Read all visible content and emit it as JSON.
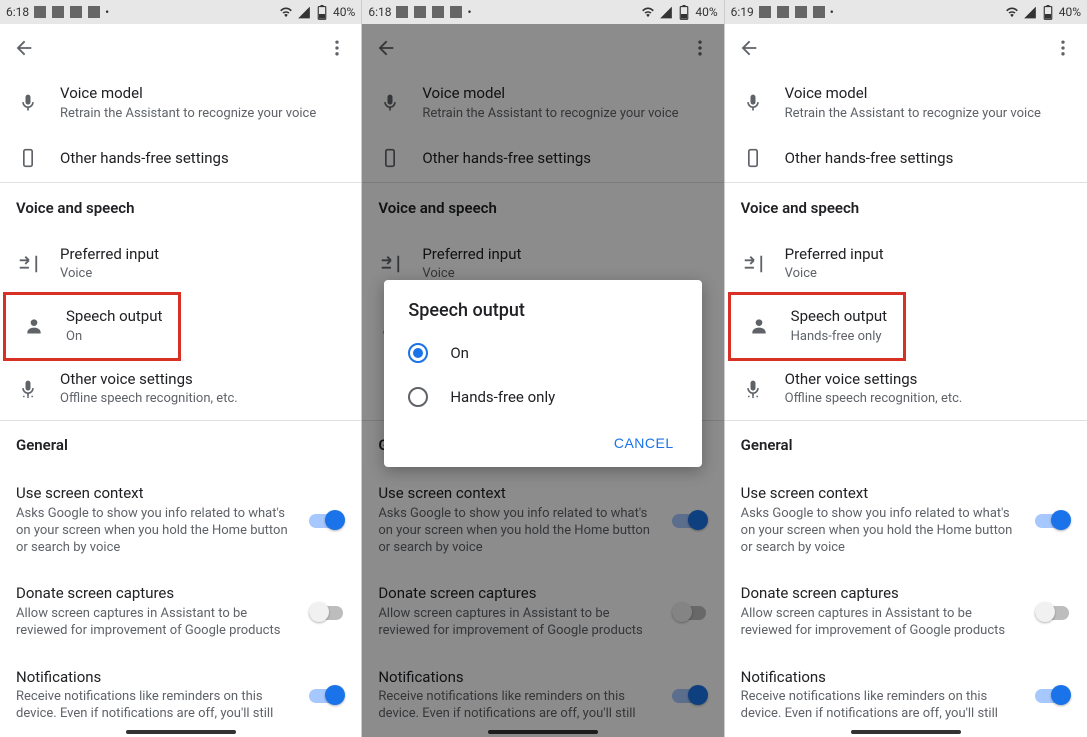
{
  "screens": [
    {
      "status": {
        "time": "6:18",
        "battery": "40%"
      },
      "voice_model": {
        "title": "Voice model",
        "sub": "Retrain the Assistant to recognize your voice"
      },
      "other_hands_free": {
        "title": "Other hands-free settings"
      },
      "sec_voice_speech": "Voice and speech",
      "preferred_input": {
        "title": "Preferred input",
        "sub": "Voice"
      },
      "speech_output": {
        "title": "Speech output",
        "sub": "On"
      },
      "other_voice": {
        "title": "Other voice settings",
        "sub": "Offline speech recognition, etc."
      },
      "sec_general": "General",
      "screen_context": {
        "title": "Use screen context",
        "sub": "Asks Google to show you info related to what's on your screen when you hold the Home button or search by voice",
        "on": true
      },
      "donate": {
        "title": "Donate screen captures",
        "sub": "Allow screen captures in Assistant to be reviewed for improvement of Google products",
        "on": false
      },
      "notifications": {
        "title": "Notifications",
        "sub": "Receive notifications like reminders on this device. Even if notifications are off, you'll still",
        "on": true
      }
    },
    {
      "status": {
        "time": "6:18",
        "battery": "40%"
      },
      "voice_model": {
        "title": "Voice model",
        "sub": "Retrain the Assistant to recognize your voice"
      },
      "other_hands_free": {
        "title": "Other hands-free settings"
      },
      "sec_voice_speech": "Voice and speech",
      "preferred_input": {
        "title": "Preferred input",
        "sub": "Voice"
      },
      "speech_output": {
        "title": "Speech output",
        "sub": "On"
      },
      "other_voice": {
        "title": "Other voice settings",
        "sub": "Offline speech recognition, etc."
      },
      "sec_general": "General",
      "screen_context": {
        "title": "Use screen context",
        "sub": "Asks Google to show you info related to what's on your screen when you hold the Home button or search by voice",
        "on": true
      },
      "donate": {
        "title": "Donate screen captures",
        "sub": "Allow screen captures in Assistant to be reviewed for improvement of Google products",
        "on": false
      },
      "notifications": {
        "title": "Notifications",
        "sub": "Receive notifications like reminders on this device. Even if notifications are off, you'll still",
        "on": true
      },
      "dialog": {
        "title": "Speech output",
        "option_on": "On",
        "option_handsfree": "Hands-free only",
        "selected": "on",
        "cancel": "CANCEL"
      }
    },
    {
      "status": {
        "time": "6:19",
        "battery": "40%"
      },
      "voice_model": {
        "title": "Voice model",
        "sub": "Retrain the Assistant to recognize your voice"
      },
      "other_hands_free": {
        "title": "Other hands-free settings"
      },
      "sec_voice_speech": "Voice and speech",
      "preferred_input": {
        "title": "Preferred input",
        "sub": "Voice"
      },
      "speech_output": {
        "title": "Speech output",
        "sub": "Hands-free only"
      },
      "other_voice": {
        "title": "Other voice settings",
        "sub": "Offline speech recognition, etc."
      },
      "sec_general": "General",
      "screen_context": {
        "title": "Use screen context",
        "sub": "Asks Google to show you info related to what's on your screen when you hold the Home button or search by voice",
        "on": true
      },
      "donate": {
        "title": "Donate screen captures",
        "sub": "Allow screen captures in Assistant to be reviewed for improvement of Google products",
        "on": false
      },
      "notifications": {
        "title": "Notifications",
        "sub": "Receive notifications like reminders on this device. Even if notifications are off, you'll still",
        "on": true
      }
    }
  ]
}
